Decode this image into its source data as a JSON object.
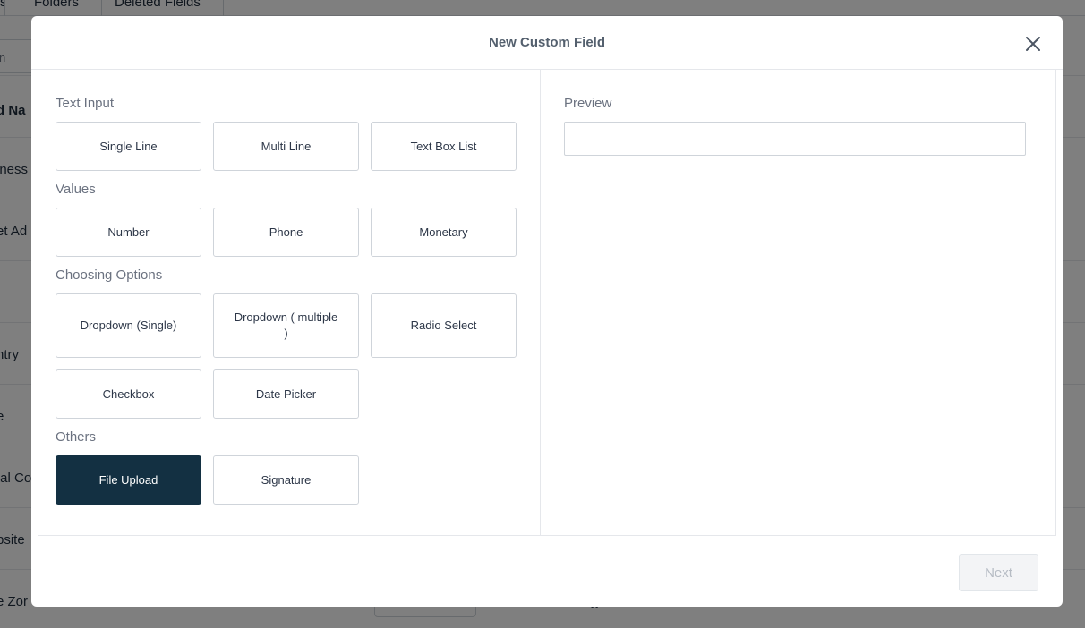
{
  "background": {
    "tabs": [
      "s",
      "Folders",
      "Deleted Fields"
    ],
    "search_fragment": "n",
    "rows": [
      {
        "text": "d Na",
        "bold": true
      },
      {
        "text": "iness",
        "bold": false
      },
      {
        "text": "et Ad",
        "bold": false
      },
      {
        "text": "",
        "bold": false
      },
      {
        "text": "ntry",
        "bold": false
      },
      {
        "text": "e",
        "bold": false
      },
      {
        "text": "tal Co",
        "bold": false
      },
      {
        "text": "bsite",
        "bold": false
      },
      {
        "text": "e Zor",
        "bold": false
      }
    ],
    "merge_fragment": "{{"
  },
  "modal": {
    "title": "New Custom Field",
    "close_icon": "close-icon",
    "sections": {
      "text_input": {
        "label": "Text Input",
        "options": [
          "Single Line",
          "Multi Line",
          "Text Box List"
        ]
      },
      "values": {
        "label": "Values",
        "options": [
          "Number",
          "Phone",
          "Monetary"
        ]
      },
      "choosing_options": {
        "label": "Choosing Options",
        "options": [
          "Dropdown (Single)",
          "Dropdown ( multiple )",
          "Radio Select",
          "Checkbox",
          "Date Picker"
        ]
      },
      "others": {
        "label": "Others",
        "options": [
          "File Upload",
          "Signature"
        ]
      }
    },
    "selected_option": "File Upload",
    "selected_color": "#133042",
    "preview": {
      "label": "Preview",
      "value": ""
    },
    "footer": {
      "next_label": "Next",
      "next_disabled": true
    }
  }
}
